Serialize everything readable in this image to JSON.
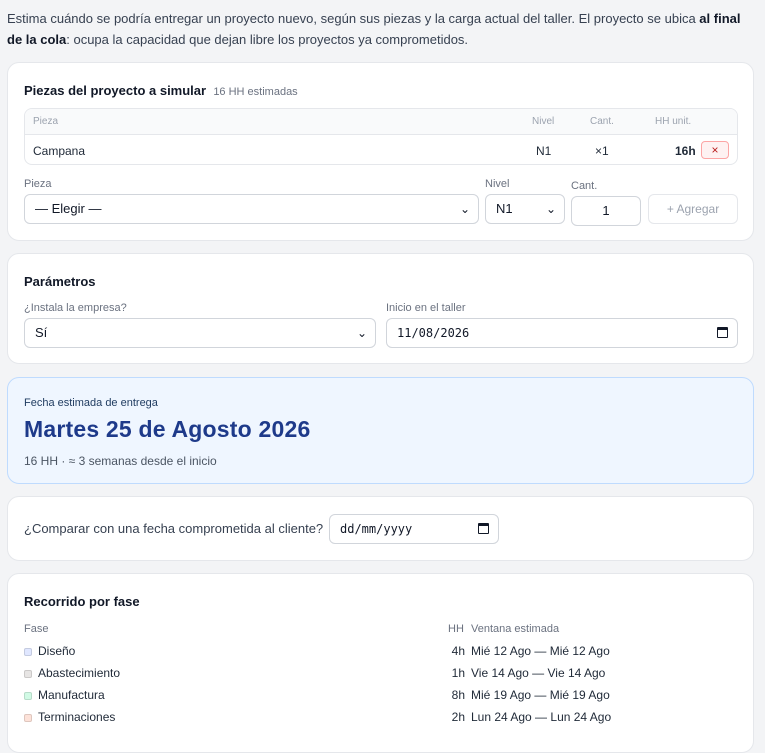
{
  "intro": {
    "text_before": "Estima cuándo se podría entregar un proyecto nuevo, según sus piezas y la carga actual del taller. El proyecto se ubica ",
    "bold1": "al final de la cola",
    "text_after": ": ocupa la capacidad que dejan libre los proyectos ya comprometidos."
  },
  "pieces": {
    "title": "Piezas del proyecto a simular",
    "estimate": "16 HH estimadas",
    "columns": [
      "Pieza",
      "Nivel",
      "Cant.",
      "HH unit."
    ],
    "rows": [
      {
        "pieza": "Campana",
        "nivel": "N1",
        "cant": "×1",
        "hh": "16h",
        "remove": "×"
      }
    ],
    "form": {
      "pieza_label": "Pieza",
      "pieza_value": "— Elegir —",
      "nivel_label": "Nivel",
      "nivel_value": "N1",
      "cant_label": "Cant.",
      "cant_value": "1",
      "add_label": "+ Agregar"
    }
  },
  "params": {
    "title": "Parámetros",
    "instala_label": "¿Instala la empresa?",
    "instala_value": "Sí",
    "inicio_label": "Inicio en el taller",
    "inicio_value": "11/08/2026"
  },
  "result": {
    "label": "Fecha estimada de entrega",
    "date": "Martes 25 de Agosto 2026",
    "sub": "16 HH · ≈ 3 semanas desde el inicio"
  },
  "compare": {
    "label": "¿Comparar con una fecha comprometida al cliente?",
    "placeholder": "dd/mm/yyyy"
  },
  "phases": {
    "title": "Recorrido por fase",
    "col_fase": "Fase",
    "col_hh": "HH",
    "col_window": "Ventana estimada",
    "rows": [
      {
        "name": "Diseño",
        "hh": "4h",
        "window": "Mié 12 Ago — Mié 12 Ago",
        "color": "#e0e7ff"
      },
      {
        "name": "Abastecimiento",
        "hh": "1h",
        "window": "Vie 14 Ago — Vie 14 Ago",
        "color": "#e7e5e4"
      },
      {
        "name": "Manufactura",
        "hh": "8h",
        "window": "Mié 19 Ago — Mié 19 Ago",
        "color": "#d1fae5"
      },
      {
        "name": "Terminaciones",
        "hh": "2h",
        "window": "Lun 24 Ago — Lun 24 Ago",
        "color": "#fde2d9"
      }
    ]
  }
}
